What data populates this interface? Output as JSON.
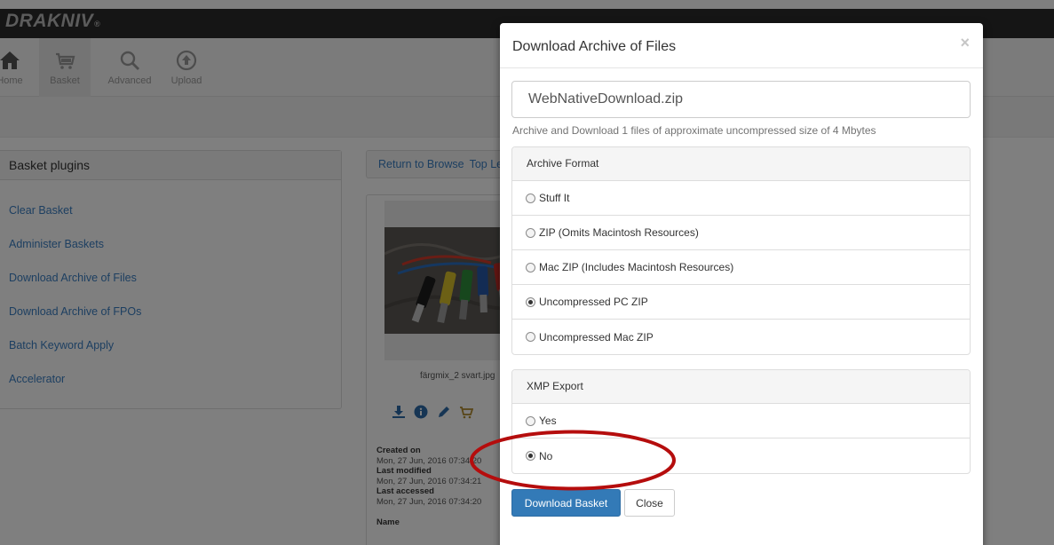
{
  "brand": {
    "logo_text": "DRAKNIV",
    "logo_sup": "®"
  },
  "navbar": {
    "items": [
      {
        "label": "Home",
        "icon": "home-icon"
      },
      {
        "label": "Basket",
        "icon": "basket-icon"
      },
      {
        "label": "Advanced",
        "icon": "search-icon"
      },
      {
        "label": "Upload",
        "icon": "upload-icon"
      }
    ]
  },
  "plugins": {
    "title": "Basket plugins",
    "items": [
      "Clear Basket",
      "Administer Baskets",
      "Download Archive of Files",
      "Download Archive of FPOs",
      "Batch Keyword Apply",
      "Accelerator"
    ]
  },
  "browse": {
    "return_label": "Return to Browse",
    "top_label": "Top Level"
  },
  "asset": {
    "filename": "färgmix_2 svart.jpg",
    "meta": [
      {
        "label": "Created on",
        "value": "Mon, 27 Jun, 2016 07:34:20"
      },
      {
        "label": "Last modified",
        "value": "Mon, 27 Jun, 2016 07:34:21"
      },
      {
        "label": "Last accessed",
        "value": "Mon, 27 Jun, 2016 07:34:20"
      },
      {
        "label": "Name",
        "value": ""
      }
    ]
  },
  "modal": {
    "title": "Download Archive of Files",
    "close_glyph": "×",
    "filename_value": "WebNativeDownload.zip",
    "help_text": "Archive and Download 1 files of approximate uncompressed size of 4 Mbytes",
    "archive_format": {
      "heading": "Archive Format",
      "options": [
        {
          "label": "Stuff It",
          "selected": false
        },
        {
          "label": "ZIP (Omits Macintosh Resources)",
          "selected": false
        },
        {
          "label": "Mac ZIP (Includes Macintosh Resources)",
          "selected": false
        },
        {
          "label": "Uncompressed PC ZIP",
          "selected": true
        },
        {
          "label": "Uncompressed Mac ZIP",
          "selected": false
        }
      ]
    },
    "xmp_export": {
      "heading": "XMP Export",
      "options": [
        {
          "label": "Yes",
          "selected": false
        },
        {
          "label": "No",
          "selected": true
        }
      ]
    },
    "primary_button": "Download Basket",
    "secondary_button": "Close"
  },
  "colors": {
    "link": "#3a7ec2",
    "primary": "#337ab7",
    "highlight": "#b50d0d",
    "brandbar": "#2b2b2b"
  }
}
